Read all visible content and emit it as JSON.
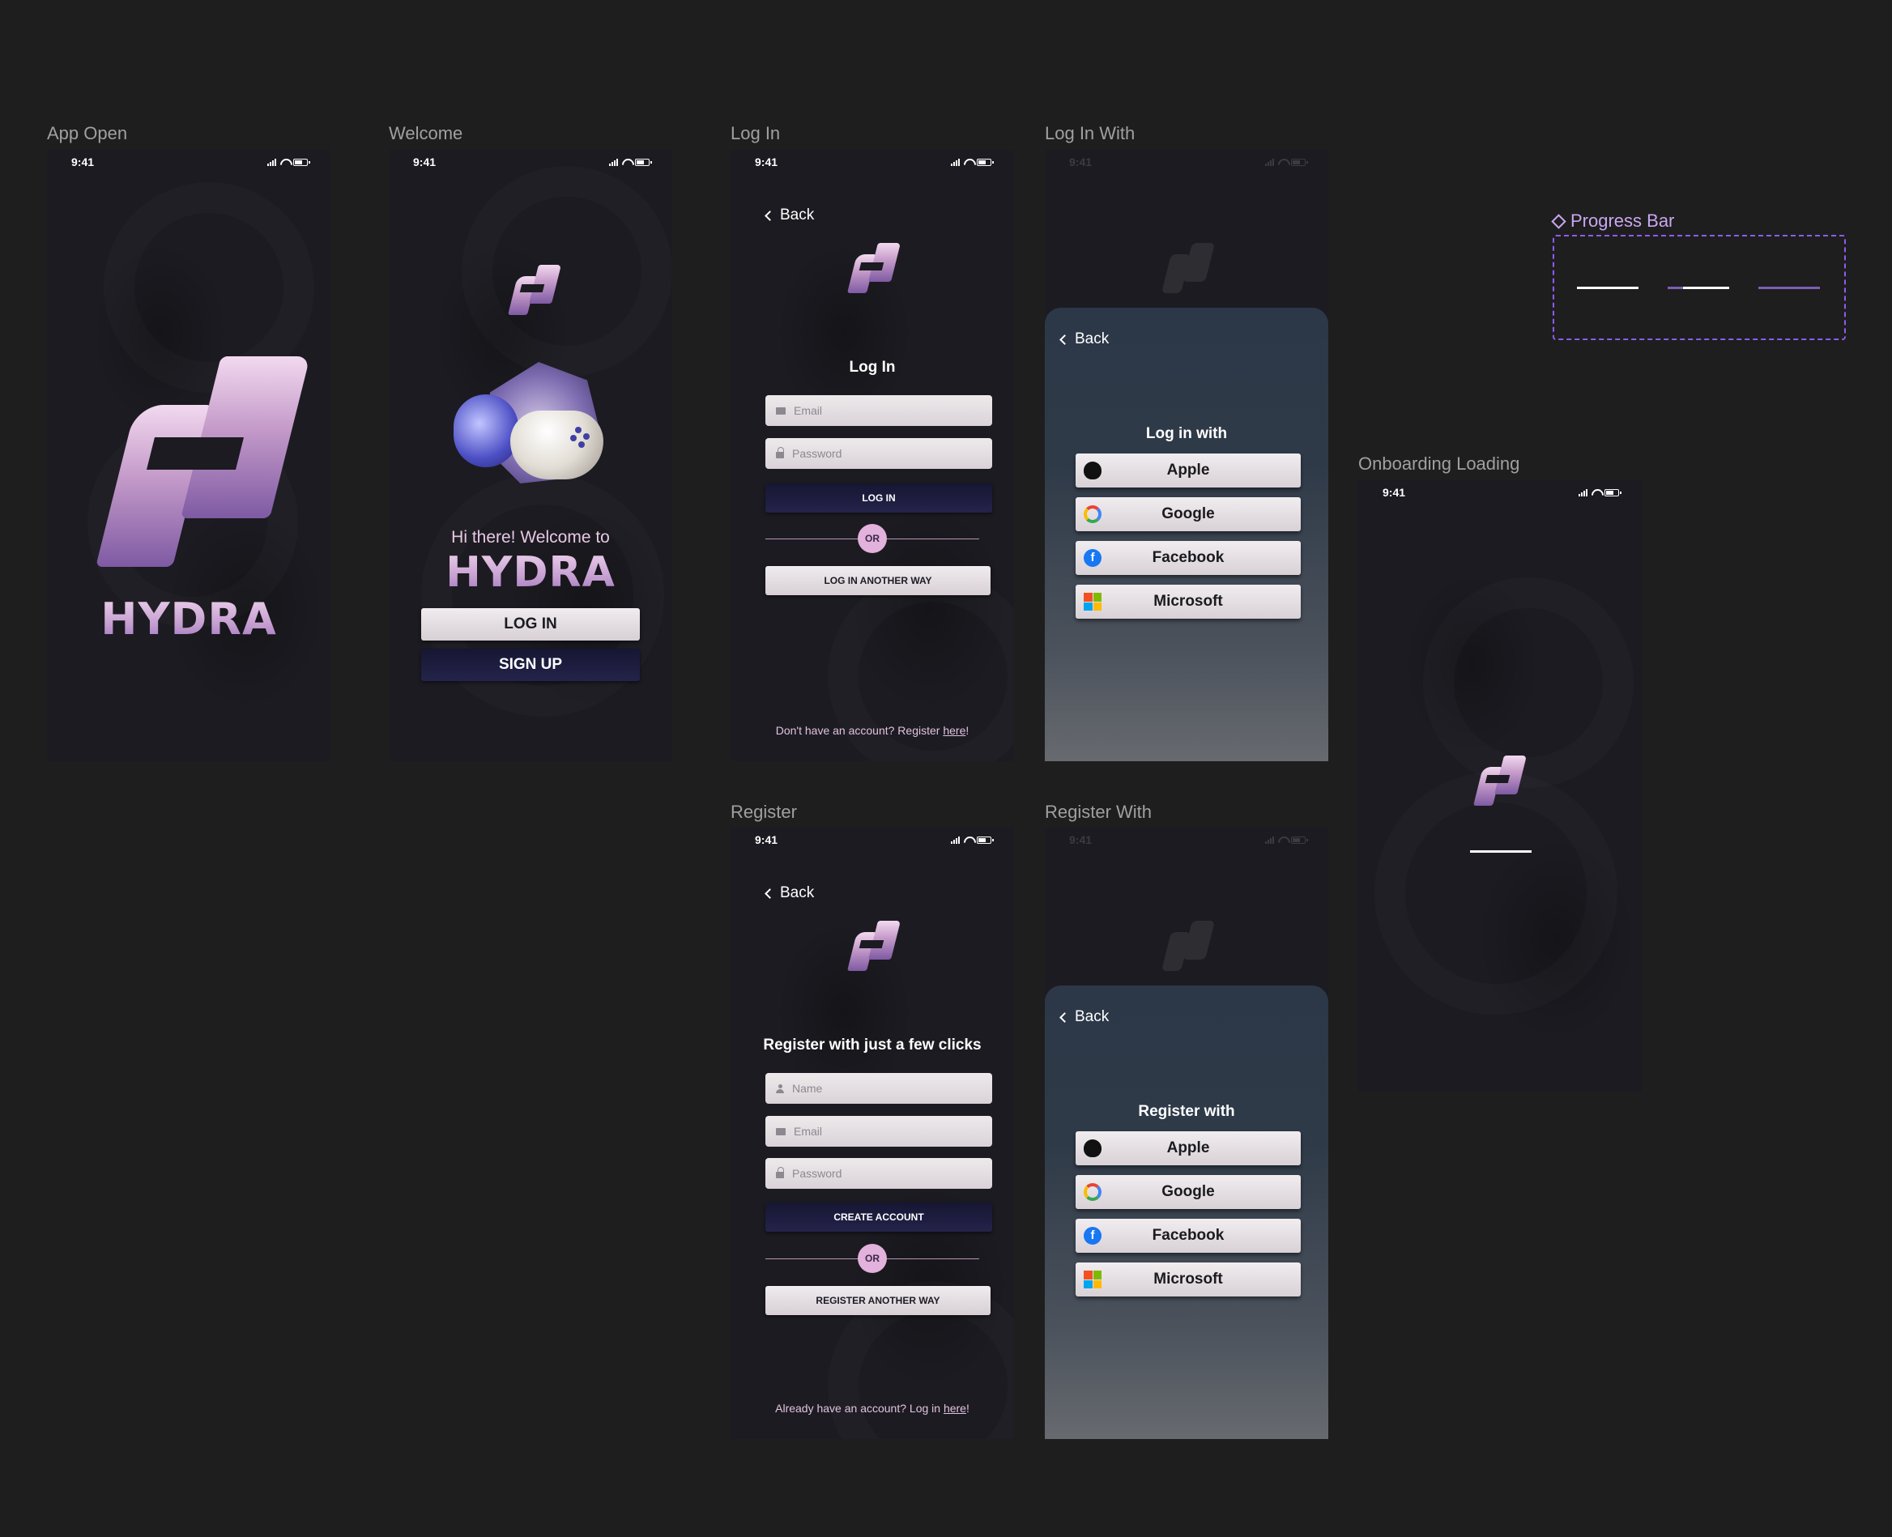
{
  "labels": {
    "app_open": "App Open",
    "welcome": "Welcome",
    "log_in": "Log In",
    "log_in_with": "Log In With",
    "register": "Register",
    "register_with": "Register With",
    "onboarding_loading": "Onboarding Loading",
    "progress_bar": "Progress Bar"
  },
  "status_bar": {
    "time": "9:41"
  },
  "brand": {
    "name": "HYDRA"
  },
  "welcome": {
    "greeting": "Hi there! Welcome to",
    "login_button": "LOG IN",
    "signup_button": "SIGN UP"
  },
  "login": {
    "back": "Back",
    "title": "Log In",
    "email_placeholder": "Email",
    "password_placeholder": "Password",
    "submit": "LOG IN",
    "or": "OR",
    "alt": "LOG IN ANOTHER WAY",
    "footer_prefix": "Don't have an account? Register ",
    "footer_link": "here",
    "footer_suffix": "!"
  },
  "login_with": {
    "back": "Back",
    "title": "Log in with",
    "providers": [
      "Apple",
      "Google",
      "Facebook",
      "Microsoft"
    ]
  },
  "register": {
    "back": "Back",
    "title": "Register with just a few clicks",
    "name_placeholder": "Name",
    "email_placeholder": "Email",
    "password_placeholder": "Password",
    "submit": "CREATE ACCOUNT",
    "or": "OR",
    "alt": "REGISTER ANOTHER WAY",
    "footer_prefix": "Already have an account? Log in ",
    "footer_link": "here",
    "footer_suffix": "!"
  },
  "register_with": {
    "back": "Back",
    "title": "Register with",
    "providers": [
      "Apple",
      "Google",
      "Facebook",
      "Microsoft"
    ]
  },
  "colors": {
    "canvas": "#1e1e1e",
    "accent": "#c9a7ef",
    "dashed_border": "#8b5cf6",
    "or_badge": "#e2b1dc"
  },
  "icons": [
    "apple-icon",
    "google-icon",
    "facebook-icon",
    "microsoft-icon",
    "mail-icon",
    "lock-icon",
    "user-icon",
    "chevron-left-icon",
    "component-diamond-icon"
  ]
}
